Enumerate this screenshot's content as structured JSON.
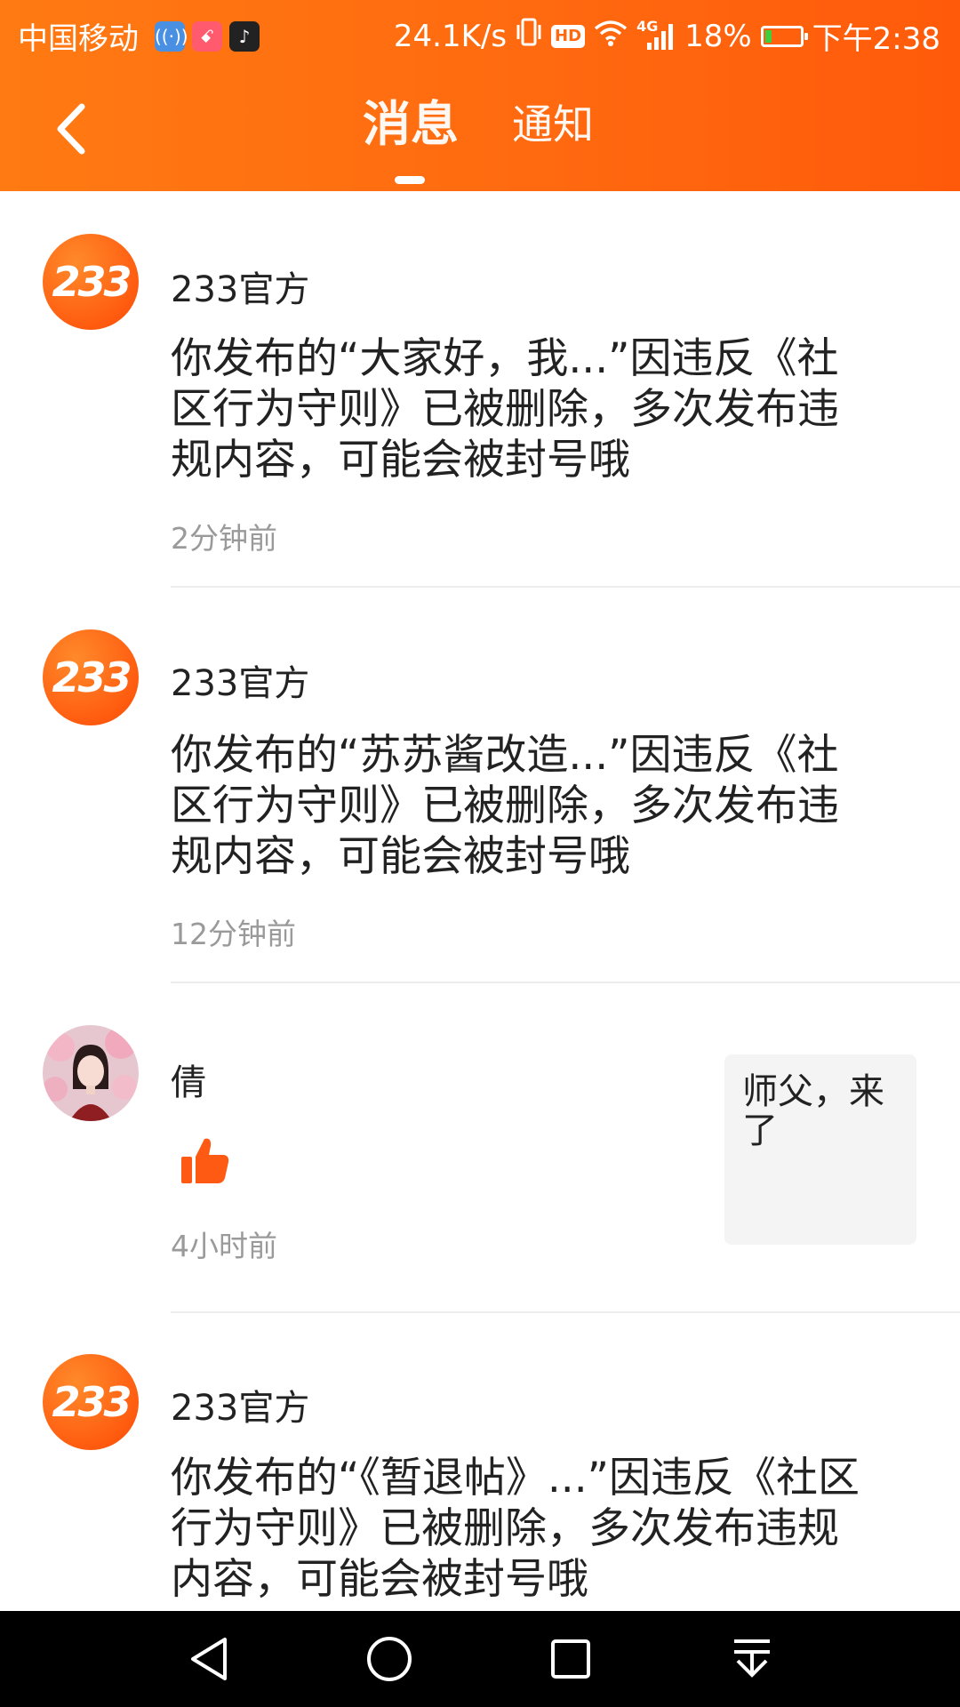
{
  "status_bar": {
    "carrier": "中国移动",
    "speed": "24.1K/s",
    "network": "4G",
    "hd_label": "HD",
    "battery": "18%",
    "battery_level": 0.18,
    "time": "下午2:38"
  },
  "header": {
    "tabs": [
      {
        "label": "消息",
        "active": true
      },
      {
        "label": "通知",
        "active": false
      }
    ]
  },
  "messages": [
    {
      "sender": "233官方",
      "avatar_text": "233",
      "body": "你发布的“大家好，我...”因违反《社区行为守则》已被删除，多次发布违规内容，可能会被封号哦",
      "time": "2分钟前"
    },
    {
      "sender": "233官方",
      "avatar_text": "233",
      "body": "你发布的“苏苏酱改造...”因违反《社区行为守则》已被删除，多次发布违规内容，可能会被封号哦",
      "time": "12分钟前"
    },
    {
      "sender": "倩",
      "quote": "师父，来了",
      "time": "4小时前"
    },
    {
      "sender": "233官方",
      "avatar_text": "233",
      "body": "你发布的“《暂退帖》...”因违反《社区行为守则》已被删除，多次发布违规内容，可能会被封号哦"
    }
  ],
  "colors": {
    "header_orange": "#ff6a10",
    "like_orange": "#ff5a14",
    "divider": "#ececec",
    "time_gray": "#9a9a9a"
  }
}
